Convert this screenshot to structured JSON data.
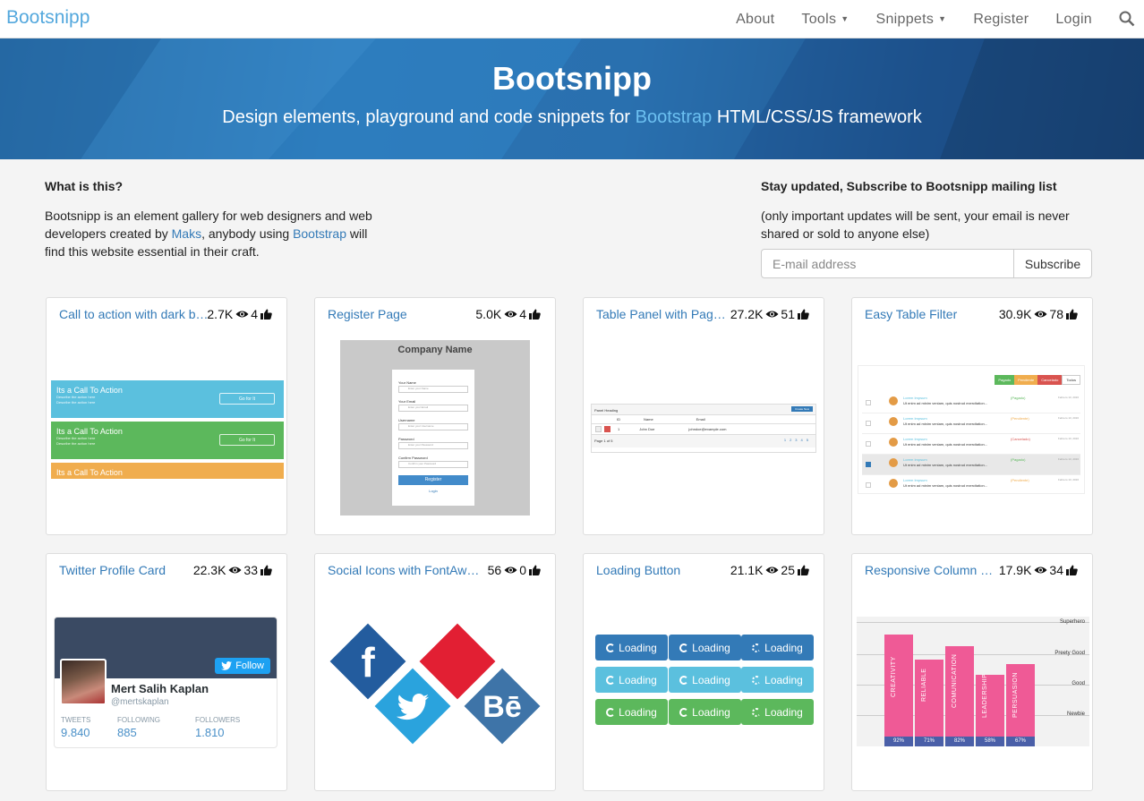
{
  "nav": {
    "brand": "Bootsnipp",
    "items": [
      {
        "label": "About"
      },
      {
        "label": "Tools"
      },
      {
        "label": "Snippets"
      },
      {
        "label": "Register"
      },
      {
        "label": "Login"
      }
    ]
  },
  "hero": {
    "title": "Bootsnipp",
    "subtitle_pre": "Design elements, playground and code snippets for ",
    "subtitle_link": "Bootstrap",
    "subtitle_post": " HTML/CSS/JS framework"
  },
  "about": {
    "heading": "What is this?",
    "text_1": "Bootsnipp is an element gallery for web designers and web developers created by ",
    "link_1": "Maks",
    "text_2": ", anybody using ",
    "link_2": "Bootstrap",
    "text_3": " will find this website essential in their craft."
  },
  "subscribe": {
    "heading": "Stay updated, Subscribe to Bootsnipp mailing list",
    "note": "(only important updates will be sent, your email is never shared or sold to anyone else)",
    "placeholder": "E-mail address",
    "button": "Subscribe"
  },
  "cards": [
    {
      "title": "Call to action with dark b…",
      "views": "2.7K",
      "likes": "4"
    },
    {
      "title": "Register Page",
      "views": "5.0K",
      "likes": "4"
    },
    {
      "title": "Table Panel with Pagi…",
      "views": "27.2K",
      "likes": "51"
    },
    {
      "title": "Easy Table Filter",
      "views": "30.9K",
      "likes": "78"
    },
    {
      "title": "Twitter Profile Card",
      "views": "22.3K",
      "likes": "33"
    },
    {
      "title": "Social Icons with FontAwe…",
      "views": "56",
      "likes": "0"
    },
    {
      "title": "Loading Button",
      "views": "21.1K",
      "likes": "25"
    },
    {
      "title": "Responsive Column C…",
      "views": "17.9K",
      "likes": "34"
    }
  ],
  "cta_preview": {
    "items": [
      {
        "title": "Its a Call To Action",
        "button": "Go for It"
      },
      {
        "title": "Its a Call To Action",
        "button": "Go for It"
      },
      {
        "title": "Its a Call To Action"
      }
    ],
    "line": "Describe the action here"
  },
  "register_preview": {
    "company": "Company Name",
    "fields": [
      "Your Name",
      "Your Email",
      "Username",
      "Password",
      "Confirm Password"
    ],
    "placeholders": [
      "Enter your Name",
      "Enter your Email",
      "Enter your Username",
      "Enter your Password",
      "Confirm your Password"
    ],
    "button": "Register",
    "login": "Login"
  },
  "table_preview": {
    "heading": "Panel Heading",
    "create": "Create New",
    "cols": [
      "ID",
      "Name",
      "Email"
    ],
    "row": [
      "1",
      "John Doe",
      "johndoe@example.com"
    ],
    "page": "Page 1 of 5",
    "pages": [
      "1",
      "2",
      "3",
      "4",
      "5"
    ]
  },
  "filter_preview": {
    "buttons": [
      "Pagado",
      "Pendiente",
      "Cancelado",
      "Todos"
    ],
    "rows": [
      {
        "name": "Lorem Impsum",
        "text": "Ut enim ad minim veniam, quis nostrud exercitation...",
        "status": "(Pagado)",
        "date": "Febrero 13, 2016"
      },
      {
        "name": "Lorem Impsum",
        "text": "Ut enim ad minim veniam, quis nostrud exercitation...",
        "status": "(Pendiente)",
        "date": "Febrero 13, 2016"
      },
      {
        "name": "Lorem Impsum",
        "text": "Ut enim ad minim veniam, quis nostrud exercitation...",
        "status": "(Cancelado)",
        "date": "Febrero 13, 2016"
      },
      {
        "name": "Lorem Impsum",
        "text": "Ut enim ad minim veniam, quis nostrud exercitation...",
        "status": "(Pagado)",
        "date": "Febrero 13, 2016"
      },
      {
        "name": "Lorem Impsum",
        "text": "Ut enim ad minim veniam, quis nostrud exercitation...",
        "status": "(Pendiente)",
        "date": "Febrero 13, 2016"
      }
    ]
  },
  "twitter_preview": {
    "follow": "Follow",
    "name": "Mert Salih Kaplan",
    "handle": "@mertskaplan",
    "stats": [
      {
        "label": "TWEETS",
        "value": "9.840"
      },
      {
        "label": "FOLLOWING",
        "value": "885"
      },
      {
        "label": "FOLLOWERS",
        "value": "1.810"
      }
    ]
  },
  "social_preview": {
    "facebook": "f",
    "behance": "Bē"
  },
  "loading_preview": {
    "label": "Loading",
    "colors": [
      "#337ab7",
      "#5bc0de",
      "#5cb85c"
    ]
  },
  "chart_preview": {
    "levels": [
      "Superhero",
      "Preety Good",
      "Good",
      "Newbie"
    ],
    "bars": [
      {
        "label": "CREATIVITY",
        "pct": "92%"
      },
      {
        "label": "RELIABLE",
        "pct": "71%"
      },
      {
        "label": "COMUNICATION",
        "pct": "82%"
      },
      {
        "label": "LEADERSHIP",
        "pct": "58%"
      },
      {
        "label": "PERSUASION",
        "pct": "67%"
      }
    ]
  },
  "colors": {
    "brand": "#54a8dd",
    "link": "#337ab7",
    "cta_blue": "#5bc0de",
    "cta_green": "#5cb85c",
    "cta_orange": "#f0ad4e",
    "pink": "#ef5a96"
  }
}
